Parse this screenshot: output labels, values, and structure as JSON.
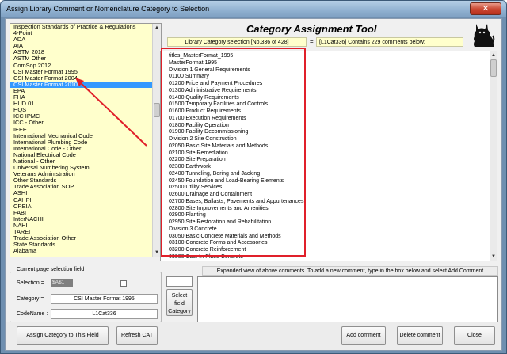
{
  "window": {
    "title": "Assign Library Comment or Nomenclature Category to Selection",
    "close_glyph": "✕"
  },
  "header": {
    "tool_title": "Category Assignment Tool",
    "selection_info": "Library Category selection [No.336 of 428]",
    "equals": "=",
    "contains_info": "[L1Cat336] Contains 229 comments below;",
    "logo_icon": "cat-silhouette-icon"
  },
  "categories": {
    "selected_index": 9,
    "items": [
      "Inspection Standards of Practice & Regulations",
      "4-Point",
      "ADA",
      "AIA",
      "ASTM 2018",
      "ASTM Other",
      "ComSop 2012",
      "CSI Master Format 1995",
      "CSI Master Format 2004",
      "CSI Master Format 2010",
      "EPA",
      "FHA",
      "HUD 01",
      "HQS",
      "ICC IPMC",
      "ICC - Other",
      "IEEE",
      "International Mechanical Code",
      "International Plumbing Code",
      "International Code - Other",
      "National Electrical Code",
      "National - Other",
      "Universal Numbering System",
      "Veterans Administration",
      "Other Standards",
      "Trade Association SOP",
      "ASHI",
      "CAHPI",
      "CREIA",
      "FABI",
      "InterNACHI",
      "NAHI",
      "TAREI",
      "Trade Association Other",
      "State Standards",
      "Alabama"
    ]
  },
  "comments": {
    "items": [
      "titles_MasterFormat_1995",
      "MasterFormat 1995",
      "Division 1 General Requirements",
      "01100 Summary",
      "01200 Price and Payment Procedures",
      "01300 Administrative Requirements",
      "01400 Quality Requirements",
      "01500 Temporary Facilities and Controls",
      "01600 Product Requirements",
      "01700 Execution Requirements",
      "01800 Facility Operation",
      "01900 Facility Decommissioning",
      "Division 2 Site Construction",
      "02050 Basic Site Materials and Methods",
      "02100 Site Remediation",
      "02200 Site Preparation",
      "02300 Earthwork",
      "02400 Tunneling, Boring and Jacking",
      "02450 Foundation and Load-Bearing Elements",
      "02500 Utility Services",
      "02600 Drainage and Containment",
      "02700 Bases, Ballasts, Pavements and Appurtenances",
      "02800 Site Improvements and Amenities",
      "02900 Planting",
      "02950 Site Restoration and Rehabilitation",
      "Division 3 Concrete",
      "03050 Basic Concrete Materials and Methods",
      "03100 Concrete Forms and Accessories",
      "03200 Concrete Reinforcement",
      "03300 Cast-In-Place Concrete"
    ]
  },
  "current_field": {
    "legend": "Current page selection field",
    "selection_label": "Selection:=",
    "selection_value": "$A$1",
    "category_label": "Category:=",
    "category_value": "CSI Master Format 1995",
    "codename_label": "CodeName :",
    "codename_value": "L1Cat336"
  },
  "expanded": {
    "label": "Expanded view of above comments. To add a new comment, type in the box below and select Add Comment"
  },
  "buttons": {
    "select_field": "Select field Category",
    "assign": "Assign Category to This Field",
    "refresh": "Refresh CAT",
    "add_comment": "Add comment",
    "delete_comment": "Delete comment",
    "close": "Close"
  },
  "colors": {
    "list_background": "#ffffcc",
    "selection_highlight": "#3399ff",
    "annotation_red": "#e0202a"
  }
}
